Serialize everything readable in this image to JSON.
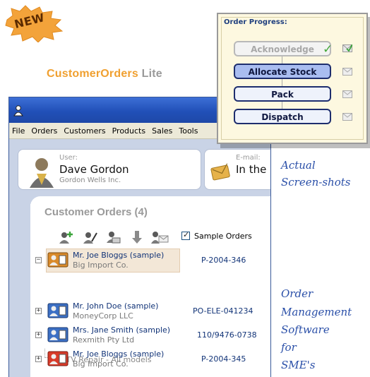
{
  "badge": {
    "new_label": "NEW"
  },
  "product": {
    "name": "CustomerOrders",
    "edition": "Lite"
  },
  "menu": [
    "File",
    "Orders",
    "Customers",
    "Products",
    "Sales",
    "Tools"
  ],
  "user": {
    "label": "User:",
    "name": "Dave Gordon",
    "company": "Gordon Wells Inc.",
    "email_label": "E-mail:",
    "email_value": "In the"
  },
  "orders": {
    "heading": "Customer Orders (4)",
    "sample_checkbox_label": "Sample Orders",
    "sample_checked": true,
    "toolbar_icons": [
      "add-customer-icon",
      "edit-order-icon",
      "print-order-icon",
      "move-down-icon",
      "email-order-icon"
    ],
    "rows": [
      {
        "name": "Mr. Joe Bloggs (sample)",
        "company": "Big Import Co.",
        "ref": "P-2004-346",
        "expanded": true,
        "selected": true,
        "icon_color": "#d98a2a"
      },
      {
        "name": "Mr. John Doe (sample)",
        "company": "MoneyCorp LLC",
        "ref": "PO-ELE-041234",
        "expanded": false,
        "selected": false,
        "icon_color": "#3b6fc4"
      },
      {
        "name": "Mrs. Jane Smith (sample)",
        "company": "Rexmith Pty Ltd",
        "ref": "110/9476-0738",
        "expanded": false,
        "selected": false,
        "icon_color": "#3b6fc4"
      },
      {
        "name": "Mr. Joe Bloggs (sample)",
        "company": "Big Import Co.",
        "ref": "P-2004-345",
        "expanded": false,
        "selected": false,
        "icon_color": "#d83b2a"
      }
    ],
    "order_line": "1 x TV Repair - All models"
  },
  "progress": {
    "title": "Order Progress:",
    "steps": [
      {
        "label": "Acknowledge",
        "state": "done"
      },
      {
        "label": "Allocate Stock",
        "state": "active"
      },
      {
        "label": "Pack",
        "state": "pending"
      },
      {
        "label": "Dispatch",
        "state": "pending"
      }
    ]
  },
  "captions": {
    "line1": "Actual",
    "line2": "Screen-shots",
    "line3": "Order",
    "line4": "Management",
    "line5": "Software",
    "line6": "for",
    "line7": "SME's"
  },
  "colors": {
    "brand_orange": "#f0a030",
    "title_blue": "#2150b8",
    "script_blue": "#2a4fa8",
    "selection": "#f3e7d7"
  }
}
